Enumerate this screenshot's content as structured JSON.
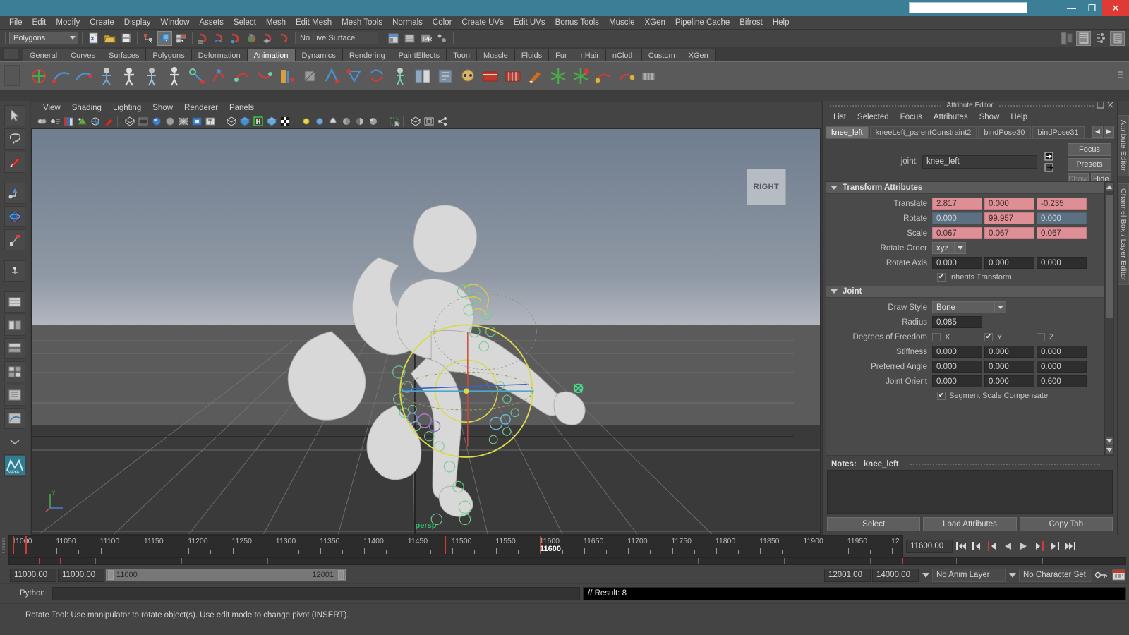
{
  "window": {
    "title": "",
    "buttons": {
      "minimize": "—",
      "maximize": "❐",
      "close": "✕"
    }
  },
  "menubar": {
    "items": [
      "File",
      "Edit",
      "Modify",
      "Create",
      "Display",
      "Window",
      "Assets",
      "Select",
      "Mesh",
      "Edit Mesh",
      "Mesh Tools",
      "Normals",
      "Color",
      "Create UVs",
      "Edit UVs",
      "Bonus Tools",
      "Muscle",
      "XGen",
      "Pipeline Cache",
      "Bifrost",
      "Help"
    ]
  },
  "statusline": {
    "mode_selector": "Polygons",
    "live_surface": "No Live Surface",
    "icons": [
      "new-scene-icon",
      "open-scene-icon",
      "save-scene-icon",
      "select-by-hierarchy-icon",
      "select-by-object-icon",
      "select-by-component-icon",
      "snap-to-grid-icon",
      "snap-to-curve-icon",
      "snap-to-point-icon",
      "snap-to-projected-center-icon",
      "snap-to-view-plane-icon",
      "make-live-icon"
    ],
    "right_icons": [
      "show-hide-editors-icon",
      "attribute-editor-toggle-icon",
      "channel-box-toggle-icon",
      "tool-settings-toggle-icon"
    ]
  },
  "shelf": {
    "tabs": [
      "General",
      "Curves",
      "Surfaces",
      "Polygons",
      "Deformation",
      "Animation",
      "Dynamics",
      "Rendering",
      "PaintEffects",
      "Toon",
      "Muscle",
      "Fluids",
      "Fur",
      "nHair",
      "nCloth",
      "Custom",
      "XGen"
    ],
    "active_tab": "Animation",
    "icon_count": 24
  },
  "toolbox": {
    "items": [
      "select-tool",
      "lasso-select-tool",
      "paint-select-tool",
      "move-tool",
      "rotate-tool",
      "scale-tool",
      "last-tool-used",
      "snap-align-tool",
      "layout-single-icon",
      "layout-two-pane-icon",
      "layout-three-pane-icon",
      "layout-four-pane-icon",
      "layout-outliner-icon",
      "layout-graph-icon",
      "layout-more-icon",
      "maya-logo-icon"
    ]
  },
  "viewport": {
    "menus": [
      "View",
      "Shading",
      "Lighting",
      "Show",
      "Renderer",
      "Panels"
    ],
    "toolbar_icons": [
      "select-camera-icon",
      "camera-attributes-icon",
      "bookmark-icon",
      "image-plane-icon",
      "two-d-pan-zoom-icon",
      "grease-pencil-icon",
      "wireframe-icon",
      "smooth-shade-icon",
      "shaded-icon",
      "flat-shade-icon",
      "wireframe-on-shaded-icon",
      "texture-icon",
      "text-display-icon",
      "xray-icon",
      "xray-joints-icon",
      "xray-active-components-icon",
      "bounding-box-icon",
      "checker-icon",
      "default-light-icon",
      "all-lights-icon",
      "shadows-icon",
      "ao-icon",
      "motion-blur-icon",
      "anti-alias-icon",
      "isolate-select-icon",
      "hud-icon",
      "grid-icon",
      "film-gate-icon",
      "share-icon"
    ],
    "view_cube_label": "RIGHT",
    "camera_label": "persp",
    "axis_label": "y",
    "scene_description": "rigged character skeleton in yoga pose with joint manipulators"
  },
  "attribute_editor": {
    "panel_title": "Attribute Editor",
    "menus": [
      "List",
      "Selected",
      "Focus",
      "Attributes",
      "Show",
      "Help"
    ],
    "tabs": [
      "knee_left",
      "kneeLeft_parentConstraint2",
      "bindPose30",
      "bindPose31"
    ],
    "active_tab": "knee_left",
    "joint_label": "joint:",
    "joint_name": "knee_left",
    "side_buttons": {
      "focus": "Focus",
      "presets": "Presets",
      "show": "Show",
      "hide": "Hide"
    },
    "transform_section": {
      "title": "Transform Attributes",
      "rows": [
        {
          "label": "Translate",
          "values": [
            "2.817",
            "0.000",
            "-0.235"
          ],
          "styles": [
            "keyed",
            "keyed",
            "keyed"
          ]
        },
        {
          "label": "Rotate",
          "values": [
            "0.000",
            "99.957",
            "0.000"
          ],
          "styles": [
            "anim",
            "keyed",
            "anim"
          ]
        },
        {
          "label": "Scale",
          "values": [
            "0.067",
            "0.067",
            "0.067"
          ],
          "styles": [
            "keyed",
            "keyed",
            "keyed"
          ]
        }
      ],
      "rotate_order_label": "Rotate Order",
      "rotate_order_value": "xyz",
      "rotate_axis_label": "Rotate Axis",
      "rotate_axis_values": [
        "0.000",
        "0.000",
        "0.000"
      ],
      "inherits_transform_label": "Inherits Transform",
      "inherits_transform_checked": true
    },
    "joint_section": {
      "title": "Joint",
      "draw_style_label": "Draw Style",
      "draw_style_value": "Bone",
      "radius_label": "Radius",
      "radius_value": "0.085",
      "dof_label": "Degrees of Freedom",
      "dof": [
        {
          "axis": "X",
          "checked": false
        },
        {
          "axis": "Y",
          "checked": true
        },
        {
          "axis": "Z",
          "checked": false
        }
      ],
      "rows": [
        {
          "label": "Stiffness",
          "values": [
            "0.000",
            "0.000",
            "0.000"
          ]
        },
        {
          "label": "Preferred Angle",
          "values": [
            "0.000",
            "0.000",
            "0.000"
          ]
        },
        {
          "label": "Joint Orient",
          "values": [
            "0.000",
            "0.000",
            "0.600"
          ]
        }
      ],
      "ssc_label": "Segment Scale Compensate",
      "ssc_checked": true
    },
    "notes_label": "Notes:",
    "notes_target": "knee_left",
    "notes_value": "",
    "footer_buttons": [
      "Select",
      "Load Attributes",
      "Copy Tab"
    ]
  },
  "right_rail": {
    "tabs": [
      "Attribute Editor",
      "Channel Box / Layer Editor"
    ]
  },
  "timeline": {
    "tick_labels": [
      "11000",
      "11050",
      "11100",
      "11150",
      "11200",
      "11250",
      "11300",
      "11350",
      "11400",
      "11450",
      "11500",
      "11550",
      "11600",
      "11650",
      "11700",
      "11750",
      "11800",
      "11850",
      "11900",
      "11950",
      "12"
    ],
    "current_frame_label": "11600",
    "current_frame_field": "11600.00",
    "key_frames": [
      "11000",
      "11010",
      "11490",
      "11600"
    ],
    "playback_buttons": [
      "go-to-start-icon",
      "step-back-key-icon",
      "step-back-frame-icon",
      "play-backward-icon",
      "play-forward-icon",
      "step-forward-frame-icon",
      "step-forward-key-icon",
      "go-to-end-icon"
    ]
  },
  "range_slider": {
    "anim_start": "11000.00",
    "anim_start_2": "11000.00",
    "range_start": "11000",
    "range_end": "12001",
    "playback_end": "12001.00",
    "anim_end": "14000.00",
    "anim_layer": "No Anim Layer",
    "character_set": "No Character Set",
    "icons": [
      "auto-key-icon",
      "animation-preferences-icon"
    ]
  },
  "command_line": {
    "language": "Python",
    "input_value": "",
    "result_text": "// Result: 8"
  },
  "help_line": {
    "text": "Rotate Tool: Use manipulator to rotate object(s). Use edit mode to change pivot (INSERT)."
  },
  "colors": {
    "title_bar": "#3c7e96",
    "close_button": "#e03a35",
    "panel_bg": "#444444",
    "keyed_field": "#de8e95",
    "animated_field": "#5d7082",
    "accent_green": "#2fbf6f",
    "keyframe_red": "#d03a3a"
  }
}
